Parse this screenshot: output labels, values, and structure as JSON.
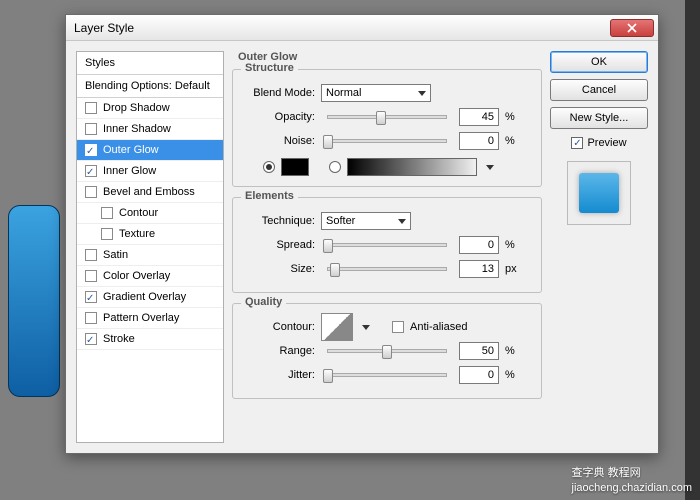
{
  "window": {
    "title": "Layer Style"
  },
  "buttons": {
    "ok": "OK",
    "cancel": "Cancel",
    "new_style": "New Style...",
    "preview": "Preview"
  },
  "sidebar": {
    "header": "Styles",
    "sub": "Blending Options: Default",
    "items": [
      {
        "label": "Drop Shadow",
        "checked": false
      },
      {
        "label": "Inner Shadow",
        "checked": false
      },
      {
        "label": "Outer Glow",
        "checked": true,
        "selected": true
      },
      {
        "label": "Inner Glow",
        "checked": true
      },
      {
        "label": "Bevel and Emboss",
        "checked": false
      },
      {
        "label": "Contour",
        "checked": false,
        "indent": true
      },
      {
        "label": "Texture",
        "checked": false,
        "indent": true
      },
      {
        "label": "Satin",
        "checked": false
      },
      {
        "label": "Color Overlay",
        "checked": false
      },
      {
        "label": "Gradient Overlay",
        "checked": true
      },
      {
        "label": "Pattern Overlay",
        "checked": false
      },
      {
        "label": "Stroke",
        "checked": true
      }
    ]
  },
  "outer_glow": {
    "title": "Outer Glow",
    "structure": {
      "legend": "Structure",
      "blend_mode_label": "Blend Mode:",
      "blend_mode_value": "Normal",
      "opacity_label": "Opacity:",
      "opacity_value": "45",
      "opacity_unit": "%",
      "noise_label": "Noise:",
      "noise_value": "0",
      "noise_unit": "%",
      "color_mode": "solid",
      "solid_color": "#000000"
    },
    "elements": {
      "legend": "Elements",
      "technique_label": "Technique:",
      "technique_value": "Softer",
      "spread_label": "Spread:",
      "spread_value": "0",
      "spread_unit": "%",
      "size_label": "Size:",
      "size_value": "13",
      "size_unit": "px"
    },
    "quality": {
      "legend": "Quality",
      "contour_label": "Contour:",
      "anti_aliased_label": "Anti-aliased",
      "anti_aliased": false,
      "range_label": "Range:",
      "range_value": "50",
      "range_unit": "%",
      "jitter_label": "Jitter:",
      "jitter_value": "0",
      "jitter_unit": "%"
    }
  },
  "watermark": {
    "site": "jiaocheng.chazidian.com",
    "cn": "查字典 教程网"
  }
}
